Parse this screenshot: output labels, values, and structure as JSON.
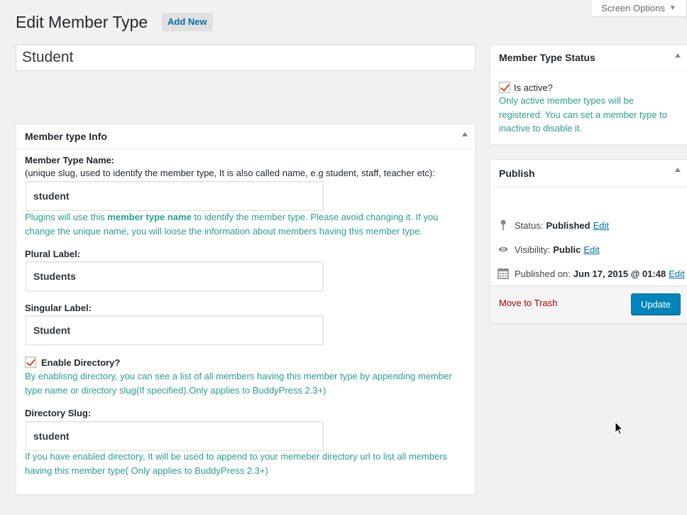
{
  "screen_options": {
    "label": "Screen Options"
  },
  "page": {
    "title": "Edit Member Type",
    "add_new_label": "Add New"
  },
  "post_title": {
    "value": "Student"
  },
  "member_type_info": {
    "heading": "Member type Info",
    "name_label": "Member Type Name:",
    "name_sub": "(unique slug, used to identify the member type, It is also called name, e.g student, staff, teacher etc):",
    "name_value": "student",
    "name_help_before": "Plugins will use this ",
    "name_help_bold": "member type name",
    "name_help_after": " to identify the member type. Please avoid changing it. If you change the unique name, you will loose the information about members having this member type.",
    "plural_label": "Plural Label:",
    "plural_value": "Students",
    "singular_label": "Singular Label:",
    "singular_value": "Student",
    "enable_directory_label": "Enable Directory?",
    "enable_directory_checked": true,
    "directory_help": "By enablisng directory, you can see a list of all members having this member type by appending member type name or directory slug(If specified).Only applies to BuddyPress 2.3+)",
    "slug_label": "Directory Slug:",
    "slug_value": "student",
    "slug_help": "If you have enabled directory, It will be used to append to your memeber directory url to list all members having this member type( Only applies to BuddyPress 2.3+)"
  },
  "status_box": {
    "heading": "Member Type Status",
    "is_active_label": "Is active?",
    "is_active_checked": true,
    "help": "Only active member types will be registered. You can set a member type to inactive to disable it."
  },
  "publish_box": {
    "heading": "Publish",
    "status_label": "Status:",
    "status_value": "Published",
    "visibility_label": "Visibility:",
    "visibility_value": "Public",
    "published_label": "Published on:",
    "published_value": "Jun 17, 2015 @ 01:48",
    "edit_label": "Edit",
    "trash_label": "Move to Trash",
    "update_label": "Update"
  },
  "colors": {
    "help_text": "#2a9d8f",
    "link": "#0073aa",
    "primary_button": "#0085ba",
    "trash": "#aa0000"
  }
}
